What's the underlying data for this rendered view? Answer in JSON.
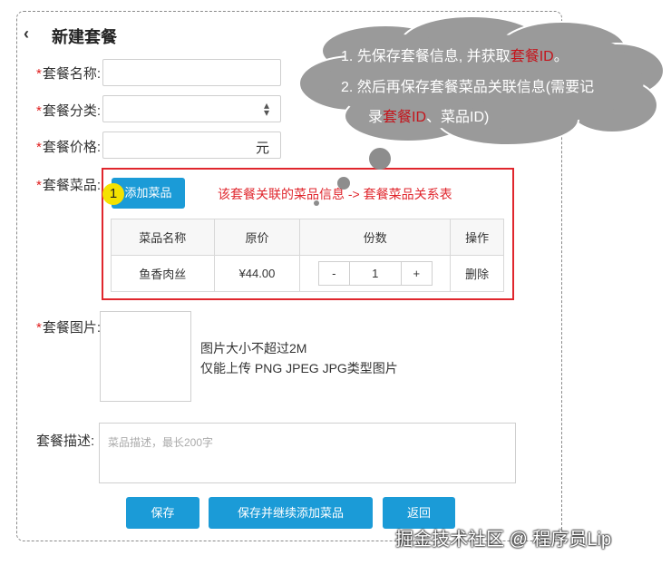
{
  "header": {
    "back_icon": "chevron-left-icon",
    "back_glyph": "‹",
    "title": "新建套餐"
  },
  "form": {
    "required_mark": "*",
    "name_label": "套餐名称:",
    "category_label": "套餐分类:",
    "category_icon": "sort-arrows-icon",
    "price_label": "套餐价格:",
    "price_suffix": "元",
    "dishes_label": "套餐菜品:",
    "add_dish_button": "添加菜品",
    "badge_number": "1",
    "dishes_note": "该套餐关联的菜品信息  ->  套餐菜品关系表",
    "dish_table": {
      "headers": [
        "菜品名称",
        "原价",
        "份数",
        "操作"
      ],
      "rows": [
        {
          "name": "鱼香肉丝",
          "price": "¥44.00",
          "minus": "-",
          "quantity": "1",
          "plus": "+",
          "action": "删除"
        }
      ]
    },
    "image_label": "套餐图片:",
    "image_hint_1": "图片大小不超过2M",
    "image_hint_2": "仅能上传 PNG JPEG JPG类型图片",
    "desc_label": "套餐描述:",
    "desc_placeholder": "菜品描述，最长200字"
  },
  "buttons": {
    "save": "保存",
    "save_continue": "保存并继续添加菜品",
    "back": "返回"
  },
  "cloud": {
    "line1_prefix": "1.   先保存套餐信息, 并获取",
    "line1_highlight": "套餐ID",
    "line1_suffix": "。",
    "line2": "2.   然后再保存套餐菜品关联信息(需要记",
    "line3_prefix": "录",
    "line3_highlight": "套餐ID",
    "line3_suffix": "、菜品ID)"
  },
  "watermark": "掘金技术社区 @ 程序员Lip",
  "colors": {
    "primary": "#1b9bd7",
    "danger": "#e0262d",
    "cloud": "#9a9a9a",
    "badge": "#f4e200"
  }
}
